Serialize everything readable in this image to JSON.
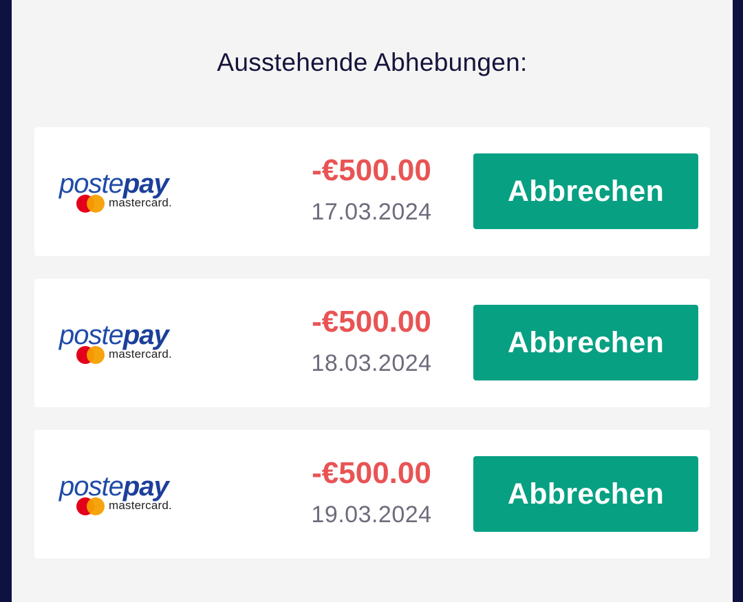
{
  "page": {
    "title": "Ausstehende Abhebungen:"
  },
  "withdrawals": [
    {
      "logo_word_poste": "poste",
      "logo_word_pay": "pay",
      "logo_sub": "mastercard.",
      "amount": "-€500.00",
      "date": "17.03.2024",
      "cancel_label": "Abbrechen"
    },
    {
      "logo_word_poste": "poste",
      "logo_word_pay": "pay",
      "logo_sub": "mastercard.",
      "amount": "-€500.00",
      "date": "18.03.2024",
      "cancel_label": "Abbrechen"
    },
    {
      "logo_word_poste": "poste",
      "logo_word_pay": "pay",
      "logo_sub": "mastercard.",
      "amount": "-€500.00",
      "date": "19.03.2024",
      "cancel_label": "Abbrechen"
    }
  ],
  "colors": {
    "background": "#0f1140",
    "panel": "#f4f4f4",
    "amount": "#e85454",
    "button": "#07a082",
    "logo_blue": "#1f4ba8"
  },
  "icons": [
    "postepay-mastercard-logo",
    "mastercard-circles-icon"
  ]
}
